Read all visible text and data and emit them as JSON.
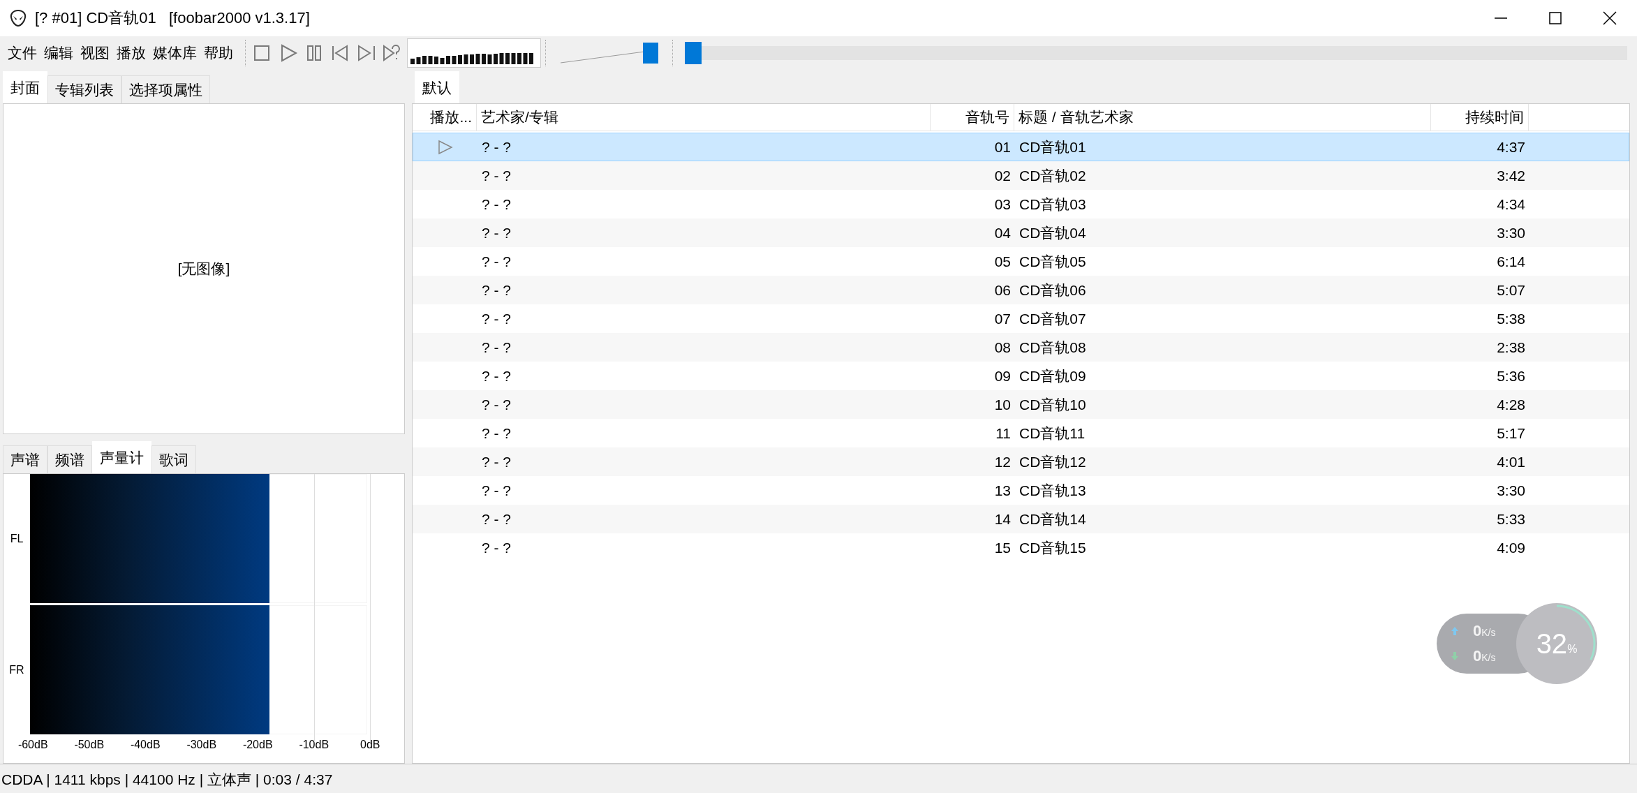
{
  "window": {
    "title": "[? #01] CD音轨01   [foobar2000 v1.3.17]"
  },
  "menu": [
    "文件",
    "编辑",
    "视图",
    "播放",
    "媒体库",
    "帮助"
  ],
  "toolbar": {
    "volume": {
      "level": 1
    },
    "seek": {
      "level": 0.0
    }
  },
  "left_top_tabs": [
    {
      "label": "封面",
      "selected": true
    },
    {
      "label": "专辑列表",
      "selected": false
    },
    {
      "label": "选择项属性",
      "selected": false
    }
  ],
  "cover": {
    "text": "[无图像]"
  },
  "left_bottom_tabs": [
    {
      "label": "声谱",
      "selected": false
    },
    {
      "label": "频谱",
      "selected": false
    },
    {
      "label": "声量计",
      "selected": true
    },
    {
      "label": "歌词",
      "selected": false
    }
  ],
  "meter": {
    "channels": [
      {
        "name": "FL",
        "level": 0.71
      },
      {
        "name": "FR",
        "level": 0.71
      }
    ],
    "scale": [
      "-60dB",
      "-50dB",
      "-40dB",
      "-30dB",
      "-20dB",
      "-10dB",
      "0dB"
    ]
  },
  "playlist_tabs": [
    {
      "label": "默认",
      "selected": true
    }
  ],
  "playlist": {
    "columns": [
      "播放...",
      "艺术家/专辑",
      "音轨号",
      "标题 / 音轨艺术家",
      "持续时间"
    ],
    "rows": [
      {
        "playing": true,
        "selected": true,
        "artist_album": "? - ?",
        "track": "01",
        "title": "CD音轨01",
        "duration": "4:37"
      },
      {
        "playing": false,
        "selected": false,
        "artist_album": "? - ?",
        "track": "02",
        "title": "CD音轨02",
        "duration": "3:42"
      },
      {
        "playing": false,
        "selected": false,
        "artist_album": "? - ?",
        "track": "03",
        "title": "CD音轨03",
        "duration": "4:34"
      },
      {
        "playing": false,
        "selected": false,
        "artist_album": "? - ?",
        "track": "04",
        "title": "CD音轨04",
        "duration": "3:30"
      },
      {
        "playing": false,
        "selected": false,
        "artist_album": "? - ?",
        "track": "05",
        "title": "CD音轨05",
        "duration": "6:14"
      },
      {
        "playing": false,
        "selected": false,
        "artist_album": "? - ?",
        "track": "06",
        "title": "CD音轨06",
        "duration": "5:07"
      },
      {
        "playing": false,
        "selected": false,
        "artist_album": "? - ?",
        "track": "07",
        "title": "CD音轨07",
        "duration": "5:38"
      },
      {
        "playing": false,
        "selected": false,
        "artist_album": "? - ?",
        "track": "08",
        "title": "CD音轨08",
        "duration": "2:38"
      },
      {
        "playing": false,
        "selected": false,
        "artist_album": "? - ?",
        "track": "09",
        "title": "CD音轨09",
        "duration": "5:36"
      },
      {
        "playing": false,
        "selected": false,
        "artist_album": "? - ?",
        "track": "10",
        "title": "CD音轨10",
        "duration": "4:28"
      },
      {
        "playing": false,
        "selected": false,
        "artist_album": "? - ?",
        "track": "11",
        "title": "CD音轨11",
        "duration": "5:17"
      },
      {
        "playing": false,
        "selected": false,
        "artist_album": "? - ?",
        "track": "12",
        "title": "CD音轨12",
        "duration": "4:01"
      },
      {
        "playing": false,
        "selected": false,
        "artist_album": "? - ?",
        "track": "13",
        "title": "CD音轨13",
        "duration": "3:30"
      },
      {
        "playing": false,
        "selected": false,
        "artist_album": "? - ?",
        "track": "14",
        "title": "CD音轨14",
        "duration": "5:33"
      },
      {
        "playing": false,
        "selected": false,
        "artist_album": "? - ?",
        "track": "15",
        "title": "CD音轨15",
        "duration": "4:09"
      }
    ]
  },
  "status_bar": "CDDA | 1411 kbps | 44100 Hz | 立体声 | 0:03 / 4:37",
  "net_widget": {
    "upload": "0",
    "upload_unit": "K/s",
    "download": "0",
    "download_unit": "K/s",
    "cpu": "32",
    "cpu_unit": "%",
    "level": 0.32
  }
}
